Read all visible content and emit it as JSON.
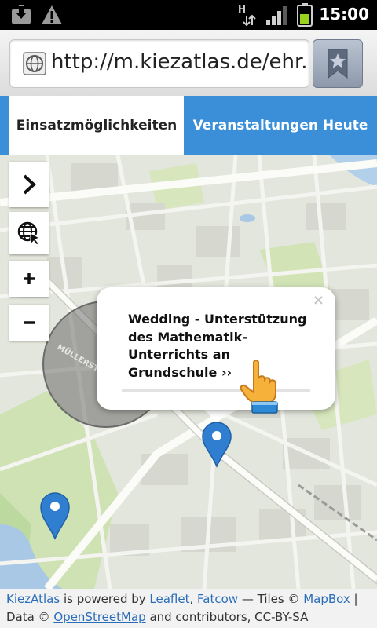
{
  "status_bar": {
    "time": "15:00",
    "icons": [
      "download-icon",
      "warning-icon",
      "hsdpa-data-icon",
      "signal-icon",
      "battery-icon"
    ]
  },
  "browser": {
    "url": "http://m.kiezatlas.de/ehr...",
    "bookmark_icon": "bookmark-star-icon"
  },
  "tabs": [
    {
      "label": "Einsatzmöglichkeiten",
      "active": true
    },
    {
      "label": "Veranstaltungen Heute",
      "active": false
    }
  ],
  "map": {
    "street_label": "MÜLLERSTRASSE",
    "controls": [
      "chevron-right-icon",
      "locate-globe-icon",
      "zoom-in-icon",
      "zoom-out-icon"
    ],
    "popup": {
      "title": "Wedding - Unterstützung des Mathematik-Unterrichts an Grundschule ››",
      "close": "×"
    }
  },
  "attribution": {
    "kiezatlas": "KiezAtlas",
    "powered_text": " is powered by ",
    "leaflet": "Leaflet",
    "comma": ", ",
    "fatcow": "Fatcow",
    "tiles_text": " — Tiles © ",
    "mapbox": "MapBox",
    "sep": " |",
    "data_text": "Data © ",
    "osm": "OpenStreetMap",
    "contrib_text": " and contributors, CC-BY-SA"
  },
  "colors": {
    "tab_blue": "#3b8fd9",
    "marker_blue": "#2f7ed0",
    "link_blue": "#2a6db8"
  }
}
